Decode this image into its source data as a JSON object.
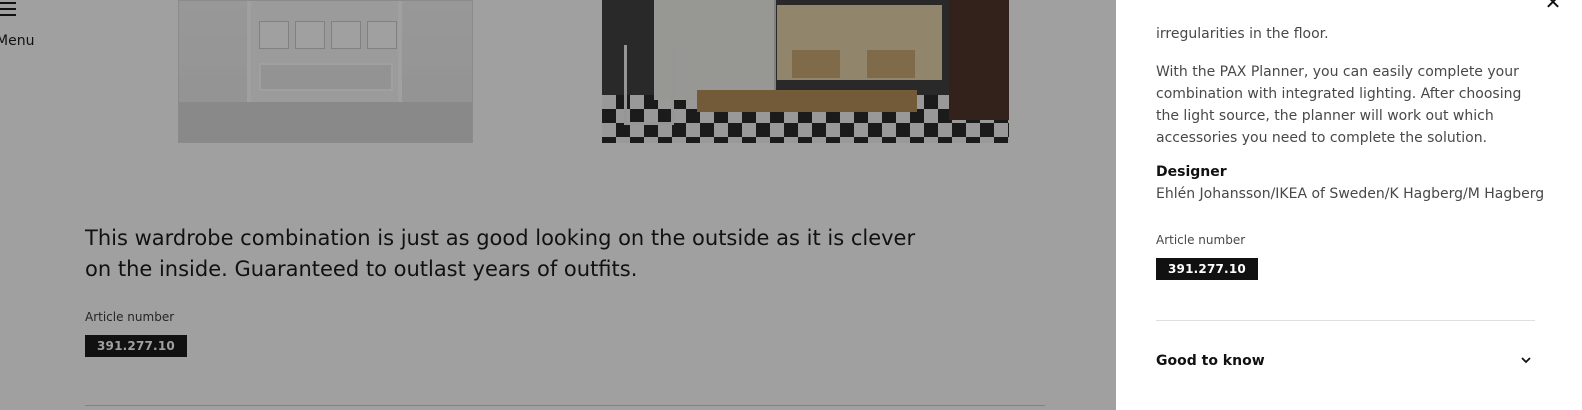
{
  "menu": {
    "label": "Menu"
  },
  "main": {
    "intro": "This wardrobe combination is just as good looking on the outside as it is clever on the inside. Guaranteed to outlast years of outfits.",
    "article_label": "Article number",
    "article_number": "391.277.10"
  },
  "panel": {
    "fragment_text": "irregularities in the floor.",
    "planner_text": "With the PAX Planner, you can easily complete your combination with integrated lighting. After choosing the light source, the planner will work out which accessories you need to complete the solution.",
    "designer_heading": "Designer",
    "designer_name": "Ehlén Johansson/IKEA of Sweden/K Hagberg/M Hagberg",
    "article_label": "Article number",
    "article_number": "391.277.10",
    "good_to_know": "Good to know"
  },
  "icons": {
    "menu": "hamburger-icon",
    "close": "close-icon",
    "expand": "chevron-down-icon"
  },
  "colors": {
    "overlay": "#111111",
    "badge": "#111111",
    "text": "#484848"
  }
}
